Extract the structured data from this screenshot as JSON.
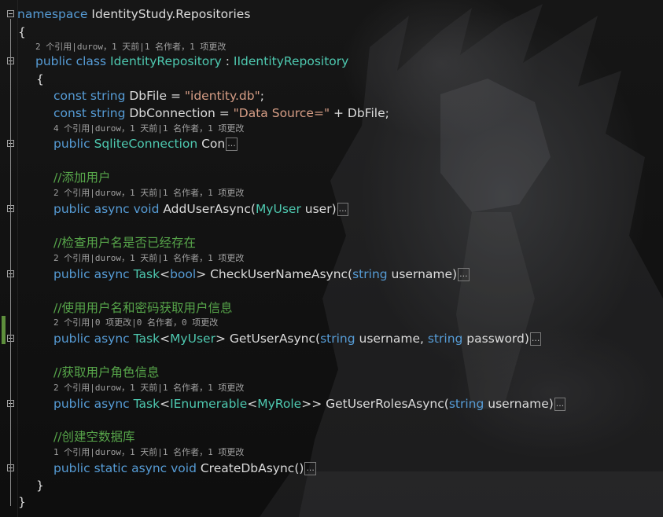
{
  "editor": {
    "namespace_kw": "namespace",
    "namespace_name": "IdentityStudy.Repositories",
    "open_brace": "{",
    "close_brace": "}",
    "class_lens": "2 个引用|durow，1 天前|1 名作者，1 项更改",
    "class_decl": {
      "public": "public",
      "class": "class",
      "name": "IdentityRepository",
      "colon": " : ",
      "base": "IIdentityRepository"
    },
    "class_open": "{",
    "class_close": "}",
    "field1": {
      "const": "const",
      "type": "string",
      "rest": " DbFile = ",
      "value": "\"identity.db\"",
      "end": ";"
    },
    "field2": {
      "const": "const",
      "type": "string",
      "rest": " DbConnection = ",
      "value": "\"Data Source=\"",
      "end": " + DbFile;"
    },
    "conn_lens": "4 个引用|durow，1 天前|1 名作者，1 项更改",
    "conn_decl": {
      "public": "public",
      "type": "SqliteConnection",
      "name": " Con"
    },
    "ellipsis": "...",
    "methods": [
      {
        "comment": "//添加用户",
        "lens": "2 个引用|durow，1 天前|1 名作者，1 项更改",
        "k1": "public",
        "k2": "async",
        "k3": "void",
        "name": " AddUserAsync(",
        "ptype": "MyUser",
        "prest": " user)"
      },
      {
        "comment": "//检查用户名是否已经存在",
        "lens": "2 个引用|durow，1 天前|1 名作者，1 项更改",
        "k1": "public",
        "k2": "async",
        "t1": "Task",
        "lt": "<",
        "t2": "bool",
        "gt": ">",
        "name": " CheckUserNameAsync(",
        "ptype": "string",
        "prest": " username)"
      },
      {
        "comment": "//使用用户名和密码获取用户信息",
        "lens": "2 个引用|0 项更改|0 名作者，0 项更改",
        "k1": "public",
        "k2": "async",
        "t1": "Task",
        "lt": "<",
        "t2": "MyUser",
        "gt": ">",
        "name": " GetUserAsync(",
        "ptype": "string",
        "pmid": " username, ",
        "ptype2": "string",
        "prest": " password)"
      },
      {
        "comment": "//获取用户角色信息",
        "lens": "2 个引用|durow，1 天前|1 名作者，1 项更改",
        "k1": "public",
        "k2": "async",
        "t1": "Task",
        "lt": "<",
        "t2": "IEnumerable",
        "lt2": "<",
        "t3": "MyRole",
        "gt": ">>",
        "name": " GetUserRolesAsync(",
        "ptype": "string",
        "prest": " username)"
      },
      {
        "comment": "//创建空数据库",
        "lens": "1 个引用|durow，1 天前|1 名作者，1 项更改",
        "k1": "public",
        "k2": "static",
        "k3": "async",
        "k4": "void",
        "name": " CreateDbAsync()"
      }
    ]
  },
  "colors": {
    "keyword": "#569cd6",
    "type": "#4ec9b0",
    "string": "#d69d85",
    "comment": "#57a64a",
    "text": "#dcdcdc",
    "background": "#141414"
  }
}
